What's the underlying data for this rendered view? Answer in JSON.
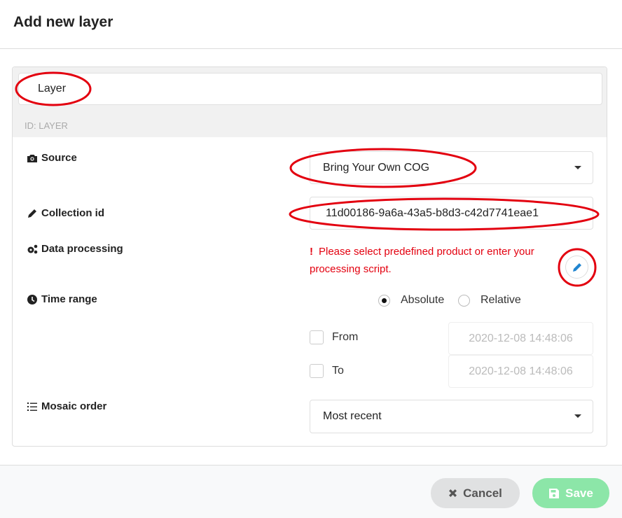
{
  "dialog": {
    "title": "Add new layer"
  },
  "name_input": {
    "value": "Layer"
  },
  "id_text": "ID: LAYER",
  "source": {
    "label": "Source",
    "value": "Bring Your Own COG"
  },
  "collection": {
    "label": "Collection id",
    "value": "11d00186-9a6a-43a5-b8d3-c42d7741eae1"
  },
  "processing": {
    "label": "Data processing",
    "error_icon": "!",
    "error": "Please select predefined product or enter your processing script."
  },
  "time_range": {
    "label": "Time range",
    "options": [
      "Absolute",
      "Relative"
    ],
    "selected": "Absolute",
    "from": {
      "label": "From",
      "value": "2020-12-08 14:48:06",
      "checked": false
    },
    "to": {
      "label": "To",
      "value": "2020-12-08 14:48:06",
      "checked": false
    }
  },
  "mosaic": {
    "label": "Mosaic order",
    "value": "Most recent"
  },
  "footer": {
    "cancel": "Cancel",
    "save": "Save"
  },
  "colors": {
    "error": "#e3000f",
    "save": "#8ce6a8",
    "annotation": "#e3000f",
    "pen": "#2185d0"
  }
}
